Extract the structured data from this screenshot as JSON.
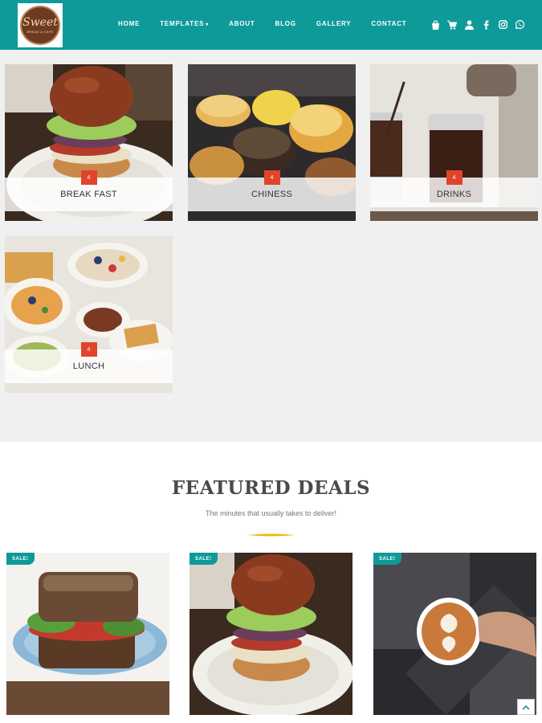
{
  "brand": {
    "logo_text": "Sweet",
    "logo_subtext": "BREAD & CAFE"
  },
  "nav": {
    "items": [
      {
        "label": "HOME"
      },
      {
        "label": "TEMPLATES"
      },
      {
        "label": "ABOUT"
      },
      {
        "label": "BLOG"
      },
      {
        "label": "GALLERY"
      },
      {
        "label": "CONTACT"
      }
    ],
    "templates_has_dropdown": true
  },
  "header_icons": [
    "bag-icon",
    "cart-icon",
    "user-icon",
    "facebook-icon",
    "instagram-icon",
    "whatsapp-icon"
  ],
  "categories": [
    {
      "label": "BREAK FAST",
      "count": "4",
      "image": "burger-photo"
    },
    {
      "label": "CHINESS",
      "count": "4",
      "image": "donuts-photo"
    },
    {
      "label": "DRINKS",
      "count": "4",
      "image": "cold-coffee-photo"
    },
    {
      "label": "LUNCH",
      "count": "4",
      "image": "lunch-spread-photo"
    }
  ],
  "featured": {
    "title": "FEATURED DEALS",
    "subtitle": "The minutes that usually takes to deliver!",
    "deals": [
      {
        "badge": "SALE!",
        "image": "sandwich-photo"
      },
      {
        "badge": "SALE!",
        "image": "burger-photo"
      },
      {
        "badge": "SALE!",
        "image": "latte-art-photo"
      }
    ]
  },
  "colors": {
    "header": "#0f9a9a",
    "accent": "#e0442b",
    "divider": "#f2b705",
    "section_bg": "#f0f0f0"
  }
}
